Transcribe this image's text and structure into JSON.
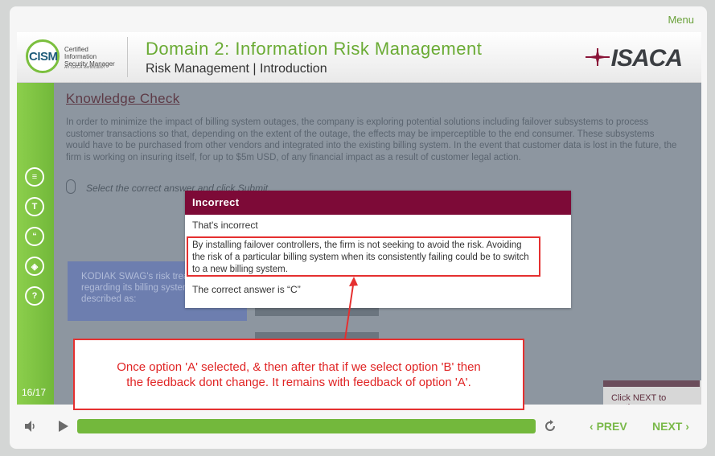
{
  "menu_label": "Menu",
  "header": {
    "logo_letters": "CISM",
    "logo_line1": "Certified Information",
    "logo_line2": "Security Manager",
    "logo_sub": "An ISACA Certification",
    "title": "Domain 2: Information Risk Management",
    "subtitle": "Risk Management | Introduction",
    "brand": "ISACA"
  },
  "sidebar": {
    "icons": [
      "notes-icon",
      "text-icon",
      "quote-icon",
      "layers-icon",
      "help-icon"
    ],
    "page_count": "16/17"
  },
  "content": {
    "heading": "Knowledge Check",
    "body": "In order to minimize the impact of billing system outages, the company is exploring potential solutions including failover subsystems to process customer transactions so that, depending on the extent of the outage, the effects may be imperceptible to the end consumer. These subsystems would have to be purchased from other vendors and integrated into the existing billing system. In the event that customer data is lost in the future, the firm is working on insuring itself, for up to $5m USD, of any financial impact as a result of customer legal action.",
    "instruction": "Select the correct answer and click Submit.",
    "question_line1": "KODIAK SWAG's risk treat",
    "question_line2": "regarding its billing system",
    "question_line3": "described as:",
    "continue": "Click NEXT to continue."
  },
  "modal": {
    "title": "Incorrect",
    "line1": "That's incorrect",
    "feedback": "By installing failover controllers, the firm is not seeking to avoid the risk. Avoiding the risk of a particular billing system when its consistently failing could be to switch to a new billing system.",
    "answer": "The correct answer is “C”"
  },
  "annotation": {
    "line1": "Once option 'A' selected, & then after that if we select option 'B' then",
    "line2": "the feedback dont change. It remains with feedback of option 'A'."
  },
  "controls": {
    "progress": 1.0,
    "prev": "PREV",
    "next": "NEXT"
  },
  "colors": {
    "accent": "#73b83c",
    "modal_header": "#7d0a37",
    "annotation": "#e53030"
  }
}
